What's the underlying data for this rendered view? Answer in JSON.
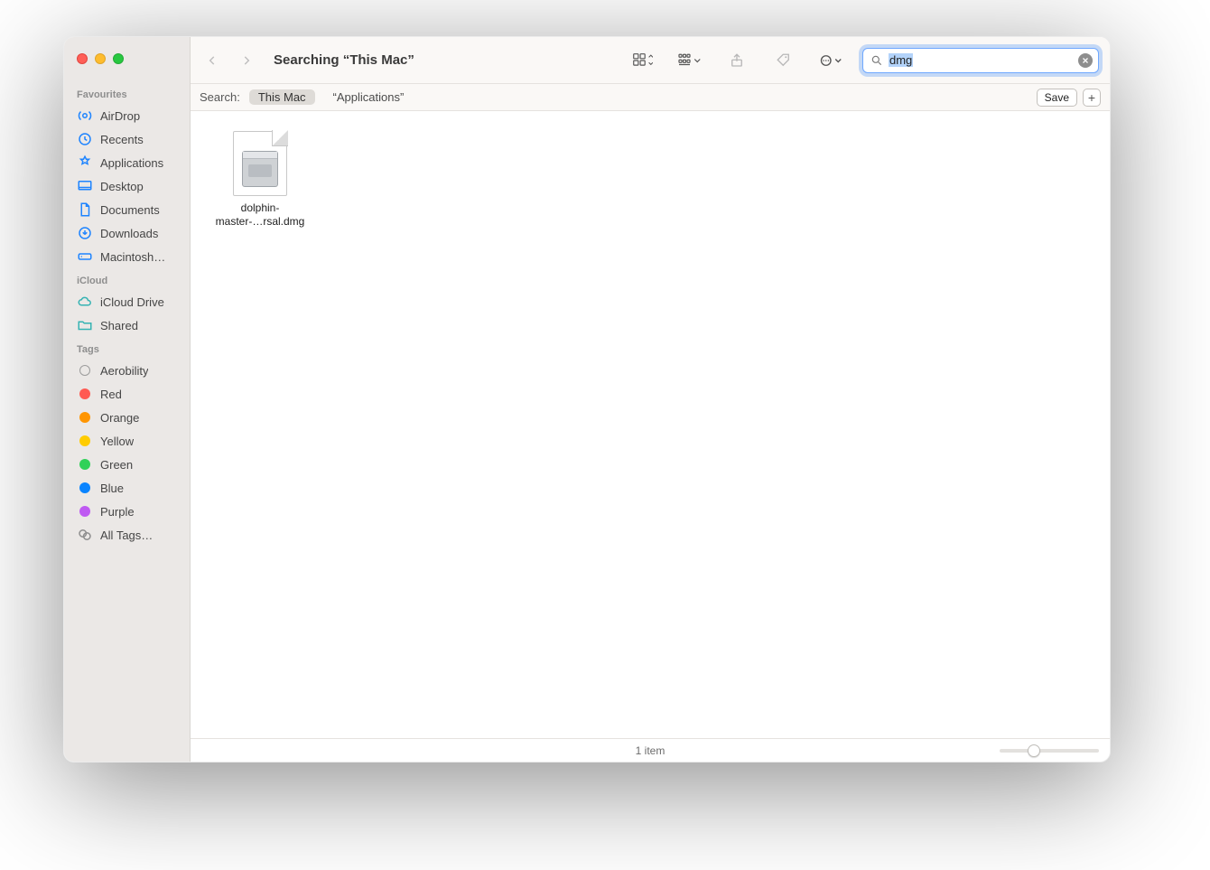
{
  "window": {
    "title": "Searching “This Mac”"
  },
  "sidebar": {
    "groups": [
      {
        "title": "Favourites",
        "items": [
          {
            "icon": "airdrop",
            "label": "AirDrop"
          },
          {
            "icon": "clock",
            "label": "Recents"
          },
          {
            "icon": "apps",
            "label": "Applications"
          },
          {
            "icon": "desktop",
            "label": "Desktop"
          },
          {
            "icon": "doc",
            "label": "Documents"
          },
          {
            "icon": "download",
            "label": "Downloads"
          },
          {
            "icon": "disk",
            "label": "Macintosh…"
          }
        ]
      },
      {
        "title": "iCloud",
        "items": [
          {
            "icon": "cloud",
            "label": "iCloud Drive"
          },
          {
            "icon": "shared",
            "label": "Shared"
          }
        ]
      },
      {
        "title": "Tags",
        "items": [
          {
            "icon": "tag-hollow",
            "label": "Aerobility",
            "color": ""
          },
          {
            "icon": "tag",
            "label": "Red",
            "color": "#ff5a52"
          },
          {
            "icon": "tag",
            "label": "Orange",
            "color": "#ff9500"
          },
          {
            "icon": "tag",
            "label": "Yellow",
            "color": "#ffcc00"
          },
          {
            "icon": "tag",
            "label": "Green",
            "color": "#30d158"
          },
          {
            "icon": "tag",
            "label": "Blue",
            "color": "#0a84ff"
          },
          {
            "icon": "tag",
            "label": "Purple",
            "color": "#bf5af2"
          },
          {
            "icon": "alltags",
            "label": "All Tags…"
          }
        ]
      }
    ]
  },
  "search": {
    "query": "dmg"
  },
  "scope": {
    "label": "Search:",
    "options": [
      "This Mac",
      "“Applications”"
    ],
    "active_index": 0,
    "save_label": "Save"
  },
  "results": {
    "items": [
      {
        "name_line1": "dolphin-",
        "name_line2": "master-…rsal.dmg"
      }
    ]
  },
  "status": {
    "text": "1 item"
  }
}
